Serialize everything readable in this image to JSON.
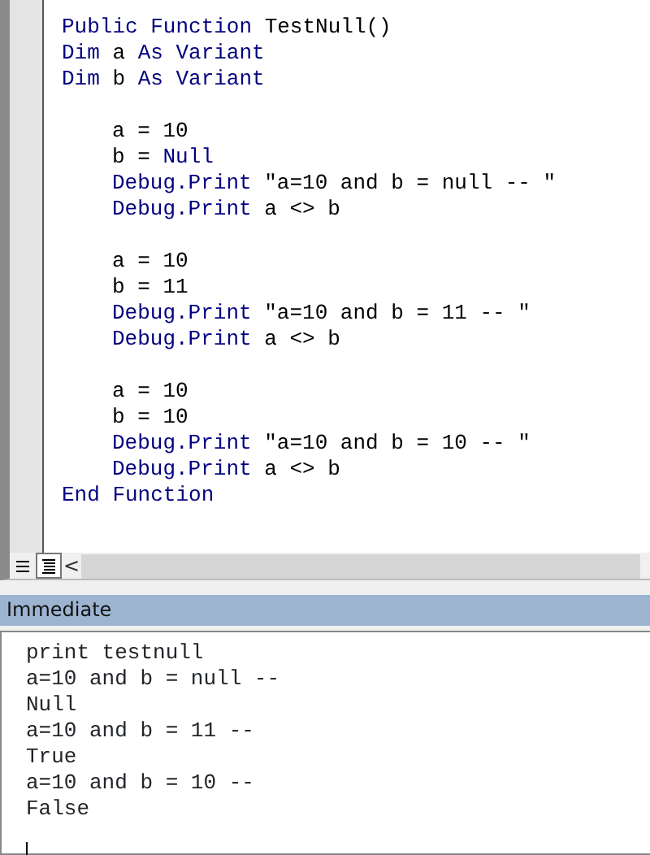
{
  "code_window": {
    "lines": [
      {
        "kind": "code",
        "tokens": [
          {
            "kind": "keyword",
            "text": "Public Function"
          },
          {
            "kind": "plain",
            "text": " TestNull()"
          }
        ]
      },
      {
        "kind": "code",
        "tokens": [
          {
            "kind": "keyword",
            "text": "Dim"
          },
          {
            "kind": "plain",
            "text": " a "
          },
          {
            "kind": "keyword",
            "text": "As Variant"
          }
        ]
      },
      {
        "kind": "code",
        "tokens": [
          {
            "kind": "keyword",
            "text": "Dim"
          },
          {
            "kind": "plain",
            "text": " b "
          },
          {
            "kind": "keyword",
            "text": "As Variant"
          }
        ]
      },
      {
        "kind": "block",
        "children": [
          {
            "kind": "blank"
          },
          {
            "kind": "code",
            "tokens": [
              {
                "kind": "plain",
                "text": "a = 10"
              }
            ]
          },
          {
            "kind": "code",
            "tokens": [
              {
                "kind": "plain",
                "text": "b = "
              },
              {
                "kind": "keyword",
                "text": "Null"
              }
            ]
          },
          {
            "kind": "code",
            "tokens": [
              {
                "kind": "keyword",
                "text": "Debug.Print"
              },
              {
                "kind": "plain",
                "text": " \"a=10 and b = null -- \""
              }
            ]
          },
          {
            "kind": "code",
            "tokens": [
              {
                "kind": "keyword",
                "text": "Debug.Print"
              },
              {
                "kind": "plain",
                "text": " a <> b"
              }
            ]
          },
          {
            "kind": "blank"
          },
          {
            "kind": "code",
            "tokens": [
              {
                "kind": "plain",
                "text": "a = 10"
              }
            ]
          },
          {
            "kind": "code",
            "tokens": [
              {
                "kind": "plain",
                "text": "b = 11"
              }
            ]
          },
          {
            "kind": "code",
            "tokens": [
              {
                "kind": "keyword",
                "text": "Debug.Print"
              },
              {
                "kind": "plain",
                "text": " \"a=10 and b = 11 -- \""
              }
            ]
          },
          {
            "kind": "code",
            "tokens": [
              {
                "kind": "keyword",
                "text": "Debug.Print"
              },
              {
                "kind": "plain",
                "text": " a <> b"
              }
            ]
          },
          {
            "kind": "blank"
          },
          {
            "kind": "code",
            "tokens": [
              {
                "kind": "plain",
                "text": "a = 10"
              }
            ]
          },
          {
            "kind": "code",
            "tokens": [
              {
                "kind": "plain",
                "text": "b = 10"
              }
            ]
          },
          {
            "kind": "code",
            "tokens": [
              {
                "kind": "keyword",
                "text": "Debug.Print"
              },
              {
                "kind": "plain",
                "text": " \"a=10 and b = 10 -- \""
              }
            ]
          },
          {
            "kind": "code",
            "tokens": [
              {
                "kind": "keyword",
                "text": "Debug.Print"
              },
              {
                "kind": "plain",
                "text": " a <> b"
              }
            ]
          }
        ]
      },
      {
        "kind": "code",
        "tokens": [
          {
            "kind": "keyword",
            "text": "End Function"
          }
        ]
      }
    ],
    "scroll_left": "<"
  },
  "immediate_window": {
    "title": "Immediate",
    "lines": [
      "print testnull",
      "a=10 and b = null --",
      "Null",
      "a=10 and b = 11 --",
      "True",
      "a=10 and b = 10 --",
      "False"
    ]
  }
}
